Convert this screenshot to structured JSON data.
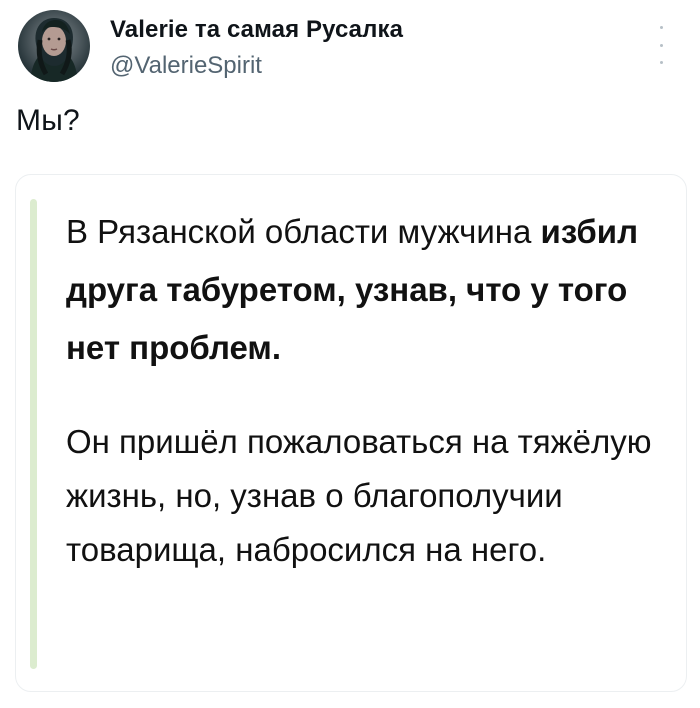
{
  "tweet": {
    "author": {
      "name": "Valerie та самая Русалка",
      "handle": "@ValerieSpirit"
    },
    "text": "Мы?"
  },
  "embedded_post": {
    "headline_normal": "В Рязанской области мужчина ",
    "headline_bold": "избил друга табуретом, узнав, что у того нет проблем.",
    "body": "Он пришёл пожаловаться на тяжёлую жизнь, но, узнав о благополучии товарища, набросился на него."
  },
  "icons": {
    "more": "more-vertical-icon",
    "avatar": "profile-avatar"
  },
  "colors": {
    "text_primary": "#0f1419",
    "text_secondary": "#536471",
    "card_border": "#eceff1",
    "accent_bar": "#dceccf"
  }
}
